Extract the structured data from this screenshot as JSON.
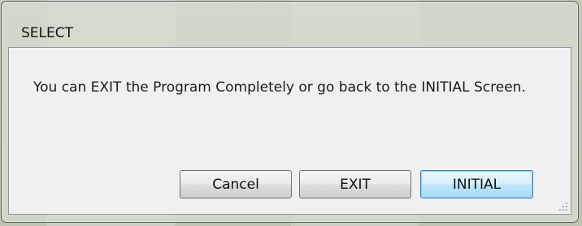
{
  "dialog": {
    "title": "SELECT",
    "message": "You can EXIT the Program Completely or go back to the INITIAL Screen."
  },
  "buttons": {
    "cancel_label": "Cancel",
    "exit_label": "EXIT",
    "initial_label": "INITIAL"
  },
  "icons": {
    "resize_grip": "resize-grip-icon"
  },
  "colors": {
    "focused_button_border": "#3c7fb1",
    "client_background": "#f0f0f0"
  }
}
